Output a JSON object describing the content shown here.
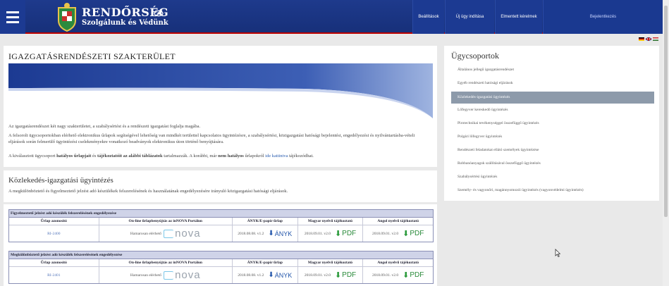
{
  "header": {
    "logo_title": "RENDŐRSÉG",
    "logo_subtitle": "Szolgálunk és Védünk",
    "nav": {
      "settings": "Beállítások",
      "new_case": "Új ügy indítása",
      "saved_cases": "Elmentett kérelmek",
      "login": "Bejelentkezés"
    }
  },
  "main": {
    "page_title": "IGAZGATÁSRENDÉSZETI SZAKTERÜLET",
    "para1": "Az igazgatásrendészet két nagy szakterületet, a szabálysértést és a rendészeti igazgatást foglalja magába.",
    "para2": "A felsorolt ügycsoportokban elérhető elektronikus űrlapok segítségével lehetőség van mindkét területtel kapcsolatos ügyintézésre, a szabálysértési, közigazgatási hatósági bejelentési, engedélyezési és nyilvántartásba-vételi eljárások során felmerülő ügyintézési cselekményekre vonatkozó beadványok elektronikus úton történő benyújtására.",
    "para3_pre": "A kiválasztott ügycsoport ",
    "para3_b1": "hatályos űrlapjait",
    "para3_mid1": " és ",
    "para3_b2": "tájékoztatóit az alábbi táblázatok",
    "para3_mid2": " tartalmazzák. A korábbi, már ",
    "para3_b3": "nem hatályos",
    "para3_mid3": " űrlapokról ",
    "para3_link": "ide kattintva",
    "para3_post": " tájékozódhat.",
    "section_title": "Közlekedés-igazgatási ügyintézés",
    "section_desc": "A megkülönböztető és figyelmeztető jelzést adó készülékek felszerelésének és használatának engedélyezésére irányuló közigazgatási hatósági eljárások."
  },
  "tables": [
    {
      "title": "Figyelmeztető jelzést adó készülék felszerelésének engedélyezése",
      "columns": [
        "Űrlap azonosító",
        "On-line űrlapbenyújtás az inNOVA Portálon",
        "ÁNYK/E-papír űrlap",
        "Magyar nyelvű tájékoztató",
        "Angol nyelvű tájékoztató"
      ],
      "form_id": "RI-2400",
      "online_text": "Hamarosan elérhető",
      "nova_text": "nova",
      "anyk_version": "2018.08.08. v1.2",
      "anyk_label": "ÁNYK",
      "hu_version": "2018.09.01. v2.0",
      "hu_label": "PDF",
      "en_version": "2018.09.01. v2.0",
      "en_label": "PDF"
    },
    {
      "title": "Megkülönböztető jelzést adó készülék felszerelésének engedélyezése",
      "columns": [
        "Űrlap azonosító",
        "On-line űrlapbenyújtás az inNOVA Portálon",
        "ÁNYK/E-papír űrlap",
        "Magyar nyelvű tájékoztató",
        "Angol nyelvű tájékoztató"
      ],
      "form_id": "RI-2401",
      "online_text": "Hamarosan elérhető",
      "nova_text": "nova",
      "anyk_version": "2018.08.08. v1.2",
      "anyk_label": "ÁNYK",
      "hu_version": "2018.09.01. v2.0",
      "hu_label": "PDF",
      "en_version": "2018.09.01. v2.0",
      "en_label": "PDF"
    }
  ],
  "sidebar": {
    "title": "Ügycsoportok",
    "items": [
      "Általános jellegű igazgatásrendészet",
      "Egyéb rendészeti hatósági eljárások",
      "Közlekedés-igazgatási ügyintézés",
      "Lőfegyver kereskedő ügyintézés",
      "Pirotechnikai tevékenységgel összefüggő ügyintézés",
      "Polgári lőfegyver ügyintézés",
      "Rendészeti feladatokat ellátó személyek ügyintézése",
      "Robbanóanyagok szállításával összefüggő ügyintézés",
      "Szabálysértési ügyintézés",
      "Személy- és vagyonőri, magánnyomozói ügyintézés (vagyonvédelmi ügyintézés)"
    ],
    "active_index": 2
  },
  "colors": {
    "header_bg": "#1e3a8c",
    "active_item": "#8d9aaa",
    "table_header": "#cfd3e8"
  }
}
